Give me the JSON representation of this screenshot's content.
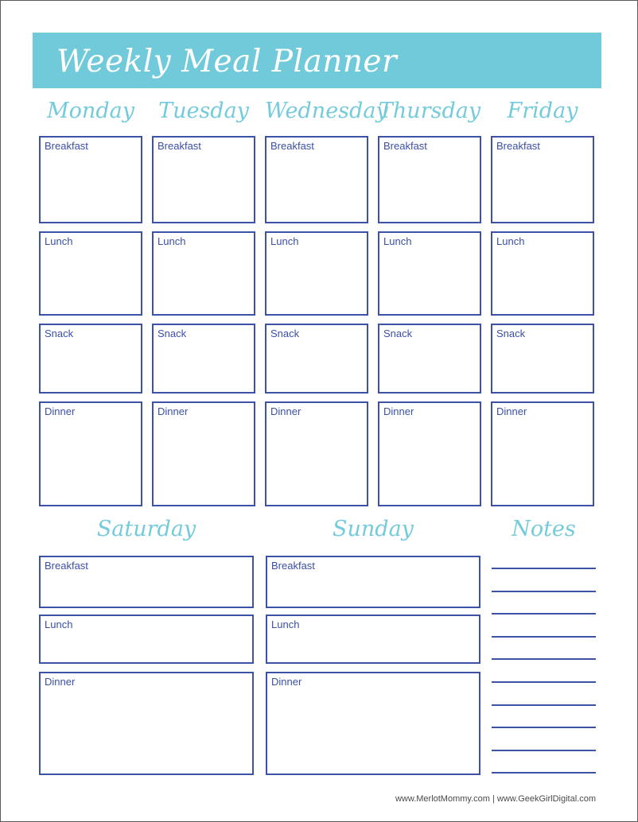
{
  "page": {
    "title": "Weekly Meal Planner",
    "accent_teal": "#71cada",
    "accent_blue": "#3a4fa8",
    "footer": "www.MerlotMommy.com | www.GeekGirlDigital.com"
  },
  "weekdays": [
    {
      "name": "Monday",
      "meals": [
        {
          "label": "Breakfast",
          "value": ""
        },
        {
          "label": "Lunch",
          "value": ""
        },
        {
          "label": "Snack",
          "value": ""
        },
        {
          "label": "Dinner",
          "value": ""
        }
      ]
    },
    {
      "name": "Tuesday",
      "meals": [
        {
          "label": "Breakfast",
          "value": ""
        },
        {
          "label": "Lunch",
          "value": ""
        },
        {
          "label": "Snack",
          "value": ""
        },
        {
          "label": "Dinner",
          "value": ""
        }
      ]
    },
    {
      "name": "Wednesday",
      "meals": [
        {
          "label": "Breakfast",
          "value": ""
        },
        {
          "label": "Lunch",
          "value": ""
        },
        {
          "label": "Snack",
          "value": ""
        },
        {
          "label": "Dinner",
          "value": ""
        }
      ]
    },
    {
      "name": "Thursday",
      "meals": [
        {
          "label": "Breakfast",
          "value": ""
        },
        {
          "label": "Lunch",
          "value": ""
        },
        {
          "label": "Snack",
          "value": ""
        },
        {
          "label": "Dinner",
          "value": ""
        }
      ]
    },
    {
      "name": "Friday",
      "meals": [
        {
          "label": "Breakfast",
          "value": ""
        },
        {
          "label": "Lunch",
          "value": ""
        },
        {
          "label": "Snack",
          "value": ""
        },
        {
          "label": "Dinner",
          "value": ""
        }
      ]
    }
  ],
  "weekend": [
    {
      "name": "Saturday",
      "meals": [
        {
          "label": "Breakfast",
          "value": ""
        },
        {
          "label": "Lunch",
          "value": ""
        },
        {
          "label": "Dinner",
          "value": ""
        }
      ]
    },
    {
      "name": "Sunday",
      "meals": [
        {
          "label": "Breakfast",
          "value": ""
        },
        {
          "label": "Lunch",
          "value": ""
        },
        {
          "label": "Dinner",
          "value": ""
        }
      ]
    }
  ],
  "notes": {
    "heading": "Notes",
    "line_count": 10,
    "lines": [
      "",
      "",
      "",
      "",
      "",
      "",
      "",
      "",
      "",
      ""
    ]
  }
}
